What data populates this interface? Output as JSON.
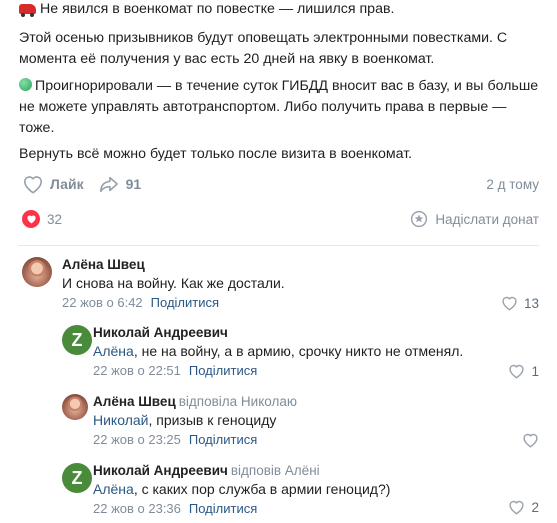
{
  "post": {
    "line1": "Не явился в военкомат по повестке — лишился прав.",
    "line2": "Этой осенью призывников будут оповещать электронными повестками. С момента её получения у вас есть 20 дней на явку в военкомат.",
    "line3": "Проигнорировали — в течение суток ГИБДД вносит вас в базу, и вы больше не можете управлять автотранспортом. Либо получить права в первые — тоже.",
    "line4": "Вернуть всё можно будет только после визита в военкомат."
  },
  "actions": {
    "like_label": "Лайк",
    "share_count": "91",
    "time": "2 д тому"
  },
  "stats": {
    "reactions_count": "32",
    "donate_label": "Надіслати донат"
  },
  "comments": [
    {
      "author": "Алёна Швец",
      "replied_to": "",
      "mention": "",
      "text": "И снова на войну. Как же достали.",
      "date": "22 жов о 6:42",
      "share": "Поділитися",
      "likes": "13"
    },
    {
      "author": "Николай Андреевич",
      "replied_to": "",
      "mention": "Алёна",
      "text": ", не на войну, а в армию, срочку никто не отменял.",
      "date": "22 жов о 22:51",
      "share": "Поділитися",
      "likes": "1"
    },
    {
      "author": "Алёна Швец",
      "replied_to": "відповіла Николаю",
      "mention": "Николай",
      "text": ", призыв к геноциду",
      "date": "22 жов о 23:25",
      "share": "Поділитися",
      "likes": ""
    },
    {
      "author": "Николай Андреевич",
      "replied_to": "відповів Алёні",
      "mention": "Алёна",
      "text": ", с каких пор служба в армии геноцид?)",
      "date": "22 жов о 23:36",
      "share": "Поділитися",
      "likes": "2"
    }
  ],
  "avatar_letter": "Z",
  "icons": {
    "car": "car-emoji",
    "dot": "green-circle-emoji",
    "like": "heart-outline-icon",
    "share": "share-arrow-icon",
    "reaction": "heart-filled-icon",
    "donate": "donate-coin-icon"
  },
  "colors": {
    "link": "#2a5885",
    "muted": "#818c99",
    "reaction": "#ff3347",
    "avatar_z": "#4a8a3b"
  }
}
